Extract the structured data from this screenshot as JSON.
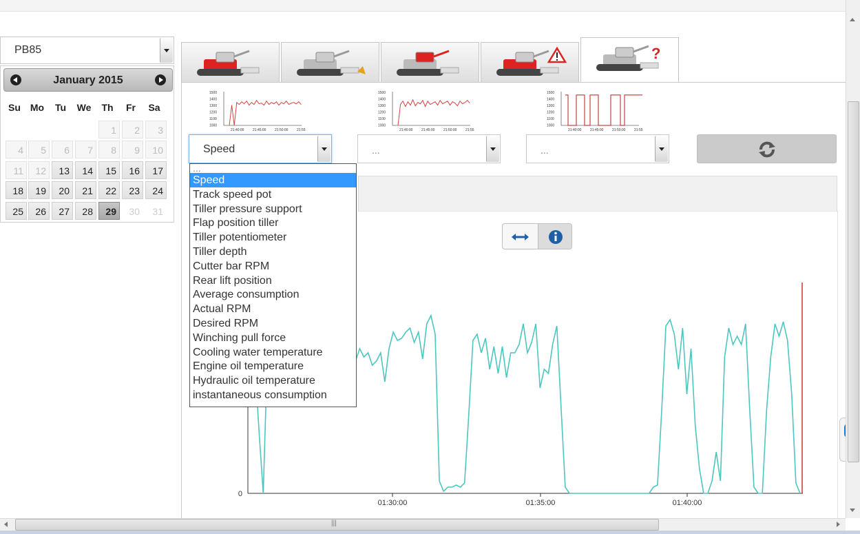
{
  "vehicle_select": {
    "value": "PB85"
  },
  "calendar": {
    "title": "January 2015",
    "weekdays": [
      "Su",
      "Mo",
      "Tu",
      "We",
      "Th",
      "Fr",
      "Sa"
    ],
    "rows": [
      [
        "",
        "",
        "",
        "",
        "1",
        "2",
        "3"
      ],
      [
        "4",
        "5",
        "6",
        "7",
        "8",
        "9",
        "10"
      ],
      [
        "11",
        "12",
        "13",
        "14",
        "15",
        "16",
        "17"
      ],
      [
        "18",
        "19",
        "20",
        "21",
        "22",
        "23",
        "24"
      ],
      [
        "25",
        "26",
        "27",
        "28",
        "29",
        "30",
        "31"
      ]
    ],
    "selected": "29"
  },
  "tabs": [
    {
      "icon": "snowcat-red-icon"
    },
    {
      "icon": "snowcat-grey-fuel-icon"
    },
    {
      "icon": "snowcat-crane-icon"
    },
    {
      "icon": "snowcat-warning-icon"
    },
    {
      "icon": "snowcat-question-icon"
    }
  ],
  "selectors": [
    {
      "value": "Speed"
    },
    {
      "value": "..."
    },
    {
      "value": "..."
    }
  ],
  "thumbnails": {
    "y_ticks": [
      "1500",
      "1400",
      "1300",
      "1200",
      "1100",
      "1000"
    ],
    "x_ticks": [
      "21:40:00",
      "21:45:00",
      "21:50:00",
      "21:55"
    ]
  },
  "dropdown_options": [
    "...",
    "Speed",
    "Track speed pot",
    "Tiller pressure support",
    "Flap position tiller",
    "Tiller potentiometer",
    "Tiller depth",
    "Cutter bar RPM",
    "Rear lift position",
    "Average consumption",
    "Actual RPM",
    "Desired RPM",
    "Winching pull force",
    "Cooling water temperature",
    "Engine oil temperature",
    "Hydraulic oil temperature",
    "instantaneous consumption"
  ],
  "dropdown_highlighted": "Speed",
  "colors": {
    "series": "#4cc6c0",
    "marker": "#d23030",
    "highlight": "#3399ff"
  },
  "chart_data": {
    "type": "line",
    "x_ticks": [
      "01:30:00",
      "01:35:00",
      "01:40:00"
    ],
    "y_ticks": [
      "0"
    ],
    "x_range": [
      "01:25:10",
      "01:43:50"
    ],
    "series": [
      {
        "values": [
          62,
          63,
          30,
          0,
          68,
          85,
          85,
          70,
          58,
          65,
          74,
          62,
          85,
          68,
          70,
          82,
          84,
          95,
          63,
          74,
          86,
          98,
          68,
          55,
          65,
          64,
          70,
          66,
          68,
          62,
          64,
          68,
          54,
          70,
          78,
          74,
          75,
          78,
          80,
          73,
          78,
          65,
          82,
          86,
          77,
          6,
          1,
          3,
          3,
          4,
          3,
          5,
          38,
          74,
          77,
          68,
          75,
          60,
          71,
          58,
          71,
          56,
          68,
          68,
          72,
          82,
          68,
          73,
          82,
          51,
          60,
          58,
          72,
          81,
          42,
          3,
          0,
          0,
          0,
          0,
          0,
          0,
          0,
          0,
          0,
          0,
          0,
          0,
          0,
          0,
          0,
          0,
          0,
          0,
          0,
          0,
          3,
          4,
          40,
          81,
          84,
          77,
          60,
          80,
          48,
          70,
          33,
          12,
          0,
          0,
          6,
          20,
          6,
          66,
          80,
          72,
          76,
          72,
          82,
          40,
          3,
          0,
          0,
          40,
          66,
          82,
          76,
          83,
          74,
          48,
          5,
          0
        ]
      }
    ],
    "marker_at_end": true
  },
  "scroll": {
    "h_grip": "|||"
  }
}
